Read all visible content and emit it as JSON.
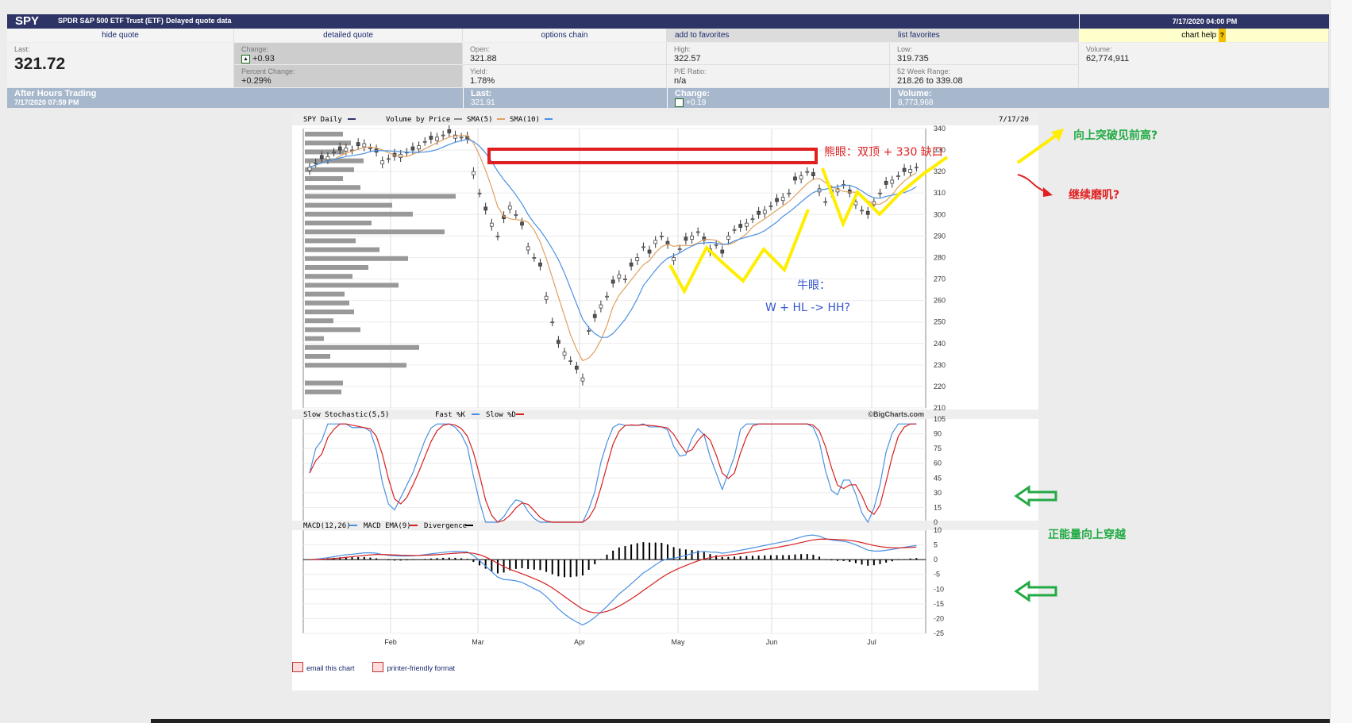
{
  "header": {
    "symbol": "SPY",
    "name": "SPDR S&P 500 ETF Trust (ETF)",
    "delay": "Delayed quote data",
    "datetime": "7/17/2020 04:00 PM"
  },
  "nav": {
    "hide": "hide quote",
    "detailed": "detailed quote",
    "options": "options chain",
    "favorites": "add to favorites",
    "list": "list favorites",
    "help": "chart help",
    "help_badge": "?"
  },
  "quote": {
    "last_label": "Last:",
    "last": "321.72",
    "change_label": "Change:",
    "change": "+0.93",
    "pct_label": "Percent Change:",
    "pct": "+0.29%",
    "open_label": "Open:",
    "open": "321.88",
    "yield_label": "Yield:",
    "yield": "1.78%",
    "high_label": "High:",
    "high": "322.57",
    "pe_label": "P/E Ratio:",
    "pe": "n/a",
    "low_label": "Low:",
    "low": "319.735",
    "range_label": "52 Week Range:",
    "range": "218.26 to 339.08",
    "vol_label": "Volume:",
    "vol": "62,774,911"
  },
  "after_hours": {
    "title": "After Hours Trading",
    "time": "7/17/2020 07:59 PM",
    "last_label": "Last:",
    "last": "321.91",
    "change_label": "Change:",
    "change": "+0.19",
    "vol_label": "Volume:",
    "vol": "8,773,968"
  },
  "price_panel": {
    "legend": "SPY Daily",
    "vbp": "Volume by Price",
    "sma5": "SMA(5)",
    "sma10": "SMA(10)",
    "date": "7/17/20",
    "yticks": [
      "340",
      "330",
      "320",
      "310",
      "300",
      "290",
      "280",
      "270",
      "260",
      "250",
      "240",
      "230",
      "220",
      "210"
    ],
    "ann_bear": "熊眼：双顶 + 330 缺口",
    "ann_bull1": "牛眼：",
    "ann_bull2": "W + HL -> HH?",
    "ann_up": "向上突破见前高?",
    "ann_side": "继续磨叽?"
  },
  "stoch_panel": {
    "legend": "Slow Stochastic(5,5)",
    "fast": "Fast %K",
    "slow": "Slow %D",
    "credit": "©BigCharts.com",
    "yticks": [
      "105",
      "90",
      "75",
      "60",
      "45",
      "30",
      "15",
      "0"
    ],
    "ann": "正能量向上穿越"
  },
  "macd_panel": {
    "legend": "MACD(12,26)",
    "ema": "MACD EMA(9)",
    "div": "Divergence",
    "yticks": [
      "10",
      "5",
      "0",
      "-5",
      "-10",
      "-15",
      "-20",
      "-25"
    ]
  },
  "xaxis": [
    "Feb",
    "Mar",
    "Apr",
    "May",
    "Jun",
    "Jul"
  ],
  "footer": {
    "email": "email this chart",
    "print": "printer-friendly format"
  },
  "colors": {
    "fastk": "#4a90e2",
    "slowd": "#d62020",
    "sma5": "#e0a060",
    "sma10": "#4a90e2",
    "ann_red": "#e02020",
    "ann_yellow": "#ffee00",
    "ann_green": "#22aa44",
    "ann_blue": "#3355cc"
  }
}
